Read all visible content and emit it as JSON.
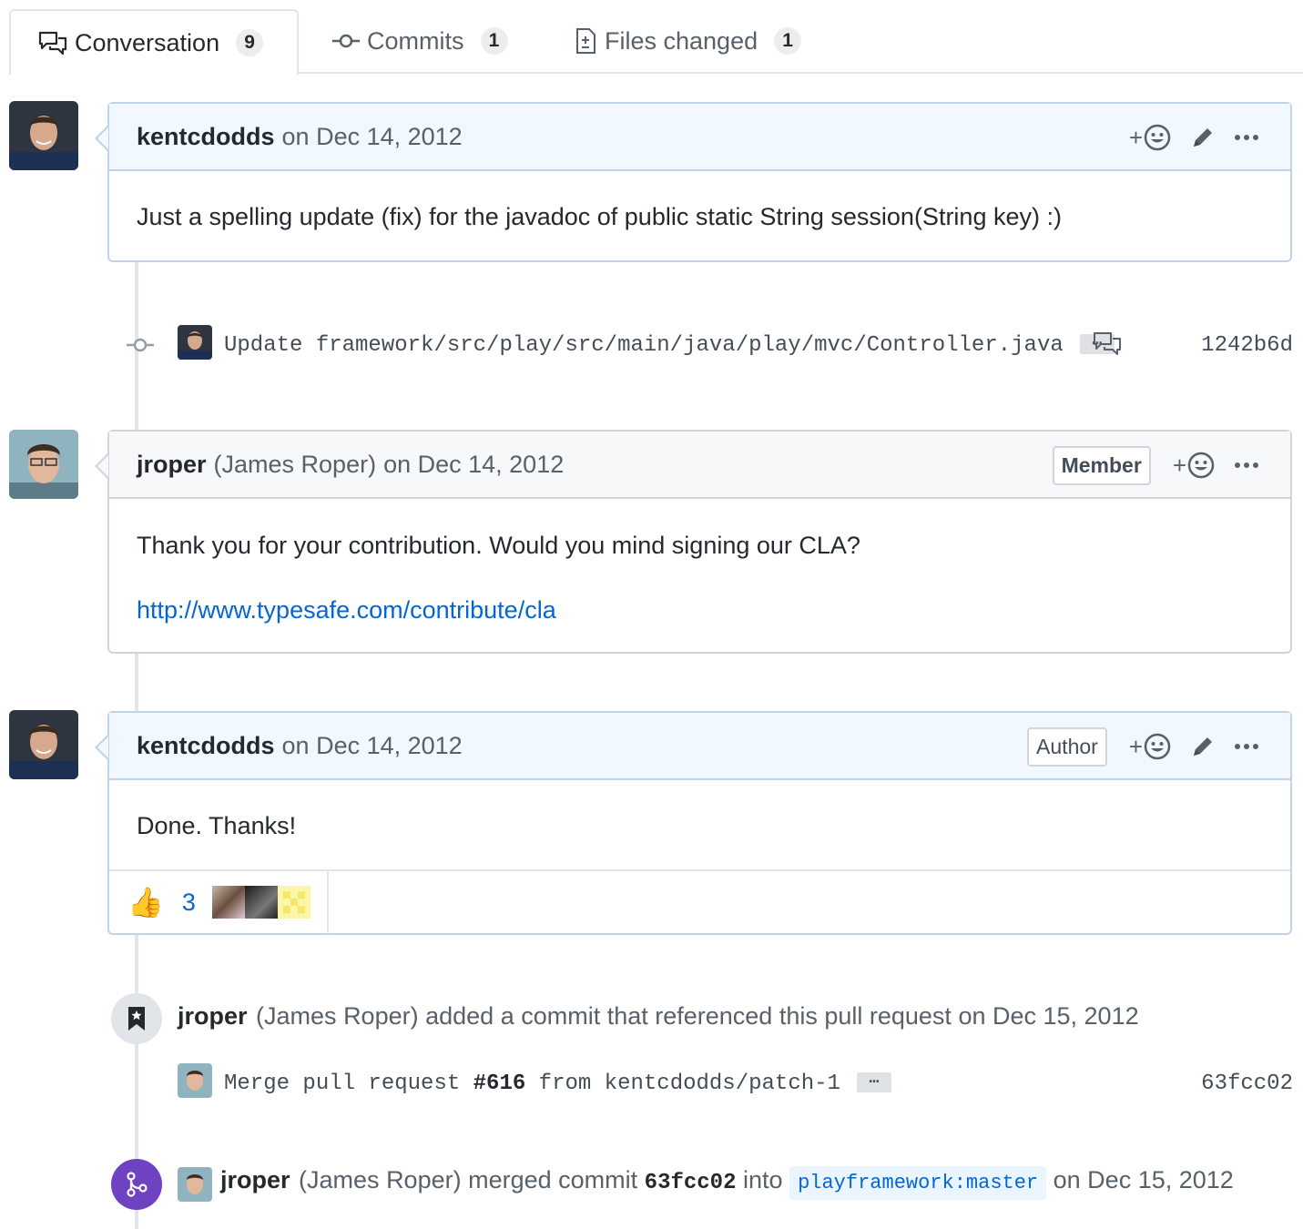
{
  "tabs": [
    {
      "label": "Conversation",
      "count": "9"
    },
    {
      "label": "Commits",
      "count": "1"
    },
    {
      "label": "Files changed",
      "count": "1"
    }
  ],
  "comments": [
    {
      "author": "kentcdodds",
      "date": "on Dec 14, 2012",
      "body": "Just a spelling update (fix) for the javadoc of public static String session(String key) :)",
      "add_reaction": "+"
    },
    {
      "author": "jroper",
      "fullname": "(James Roper)",
      "date": "on Dec 14, 2012",
      "badge": "Member",
      "body": "Thank you for your contribution. Would you mind signing our CLA?",
      "link": "http://www.typesafe.com/contribute/cla",
      "add_reaction": "+"
    },
    {
      "author": "kentcdodds",
      "date": "on Dec 14, 2012",
      "badge": "Author",
      "body": "Done. Thanks!",
      "add_reaction": "+",
      "reaction_emoji": "👍",
      "reaction_count": "3"
    }
  ],
  "commit1": {
    "message": "Update framework/src/play/src/main/java/play/mvc/Controller.java",
    "ellipsis": "…",
    "sha": "1242b6d"
  },
  "reference_event": {
    "author": "jroper",
    "fullname": "(James Roper)",
    "text": "added a commit that referenced this pull request",
    "date": "on Dec 15, 2012"
  },
  "commit2": {
    "msg_a": "Merge pull request",
    "msg_pr": "#616",
    "msg_b": "from kentcdodds/patch-1",
    "ellipsis": "…",
    "sha": "63fcc02"
  },
  "merge_event": {
    "author": "jroper",
    "fullname": "(James Roper)",
    "text_a": "merged commit",
    "sha": "63fcc02",
    "text_b": "into",
    "branch": "playframework:master",
    "date": "on Dec 15, 2012"
  },
  "colors": {
    "link": "#0366d6",
    "merged_purple": "#6f42c1",
    "header_blue": "#f1f8ff"
  }
}
